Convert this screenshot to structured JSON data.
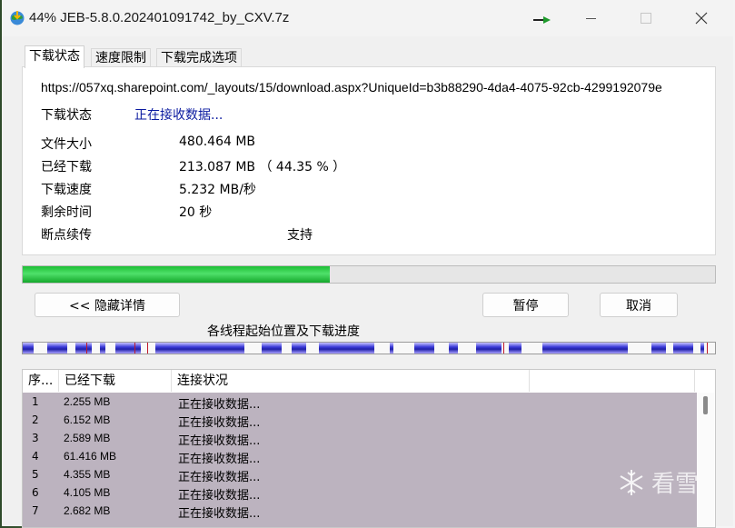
{
  "window": {
    "title": "44% JEB-5.8.0.202401091742_by_CXV.7z"
  },
  "tabs": [
    {
      "label": "下载状态",
      "active": true
    },
    {
      "label": "速度限制",
      "active": false
    },
    {
      "label": "下载完成选项",
      "active": false
    }
  ],
  "status": {
    "url": "https://057xq.sharepoint.com/_layouts/15/download.aspx?UniqueId=b3b88290-4da4-4075-92cb-4299192079e",
    "status_label": "下载状态",
    "status_value": "正在接收数据...",
    "file_size_label": "文件大小",
    "file_size_value": "480.464  MB",
    "downloaded_label": "已经下载",
    "downloaded_value": "213.087  MB （ 44.35 % ）",
    "speed_label": "下载速度",
    "speed_value": "5.232  MB/秒",
    "remaining_label": "剩余时间",
    "remaining_value": "20 秒",
    "resume_label": "断点续传",
    "resume_value": "支持"
  },
  "progress": {
    "fraction": 0.4435,
    "color": "#1dbf35"
  },
  "buttons": {
    "hide_details": "<< 隐藏详情",
    "pause": "暂停",
    "cancel": "取消"
  },
  "segments": {
    "title": "各线程起始位置及下载进度"
  },
  "connections": {
    "headers": [
      "序...",
      "已经下载",
      "连接状况",
      ""
    ],
    "rows": [
      {
        "id": "1",
        "downloaded": "2.255  MB",
        "status": "正在接收数据..."
      },
      {
        "id": "2",
        "downloaded": "6.152  MB",
        "status": "正在接收数据..."
      },
      {
        "id": "3",
        "downloaded": "2.589  MB",
        "status": "正在接收数据..."
      },
      {
        "id": "4",
        "downloaded": "61.416  MB",
        "status": "正在接收数据..."
      },
      {
        "id": "5",
        "downloaded": "4.355  MB",
        "status": "正在接收数据..."
      },
      {
        "id": "6",
        "downloaded": "4.105  MB",
        "status": "正在接收数据..."
      },
      {
        "id": "7",
        "downloaded": "2.682  MB",
        "status": "正在接收数据..."
      }
    ],
    "row_color": "#bcb3bf"
  },
  "watermark": {
    "text": "看雪"
  }
}
